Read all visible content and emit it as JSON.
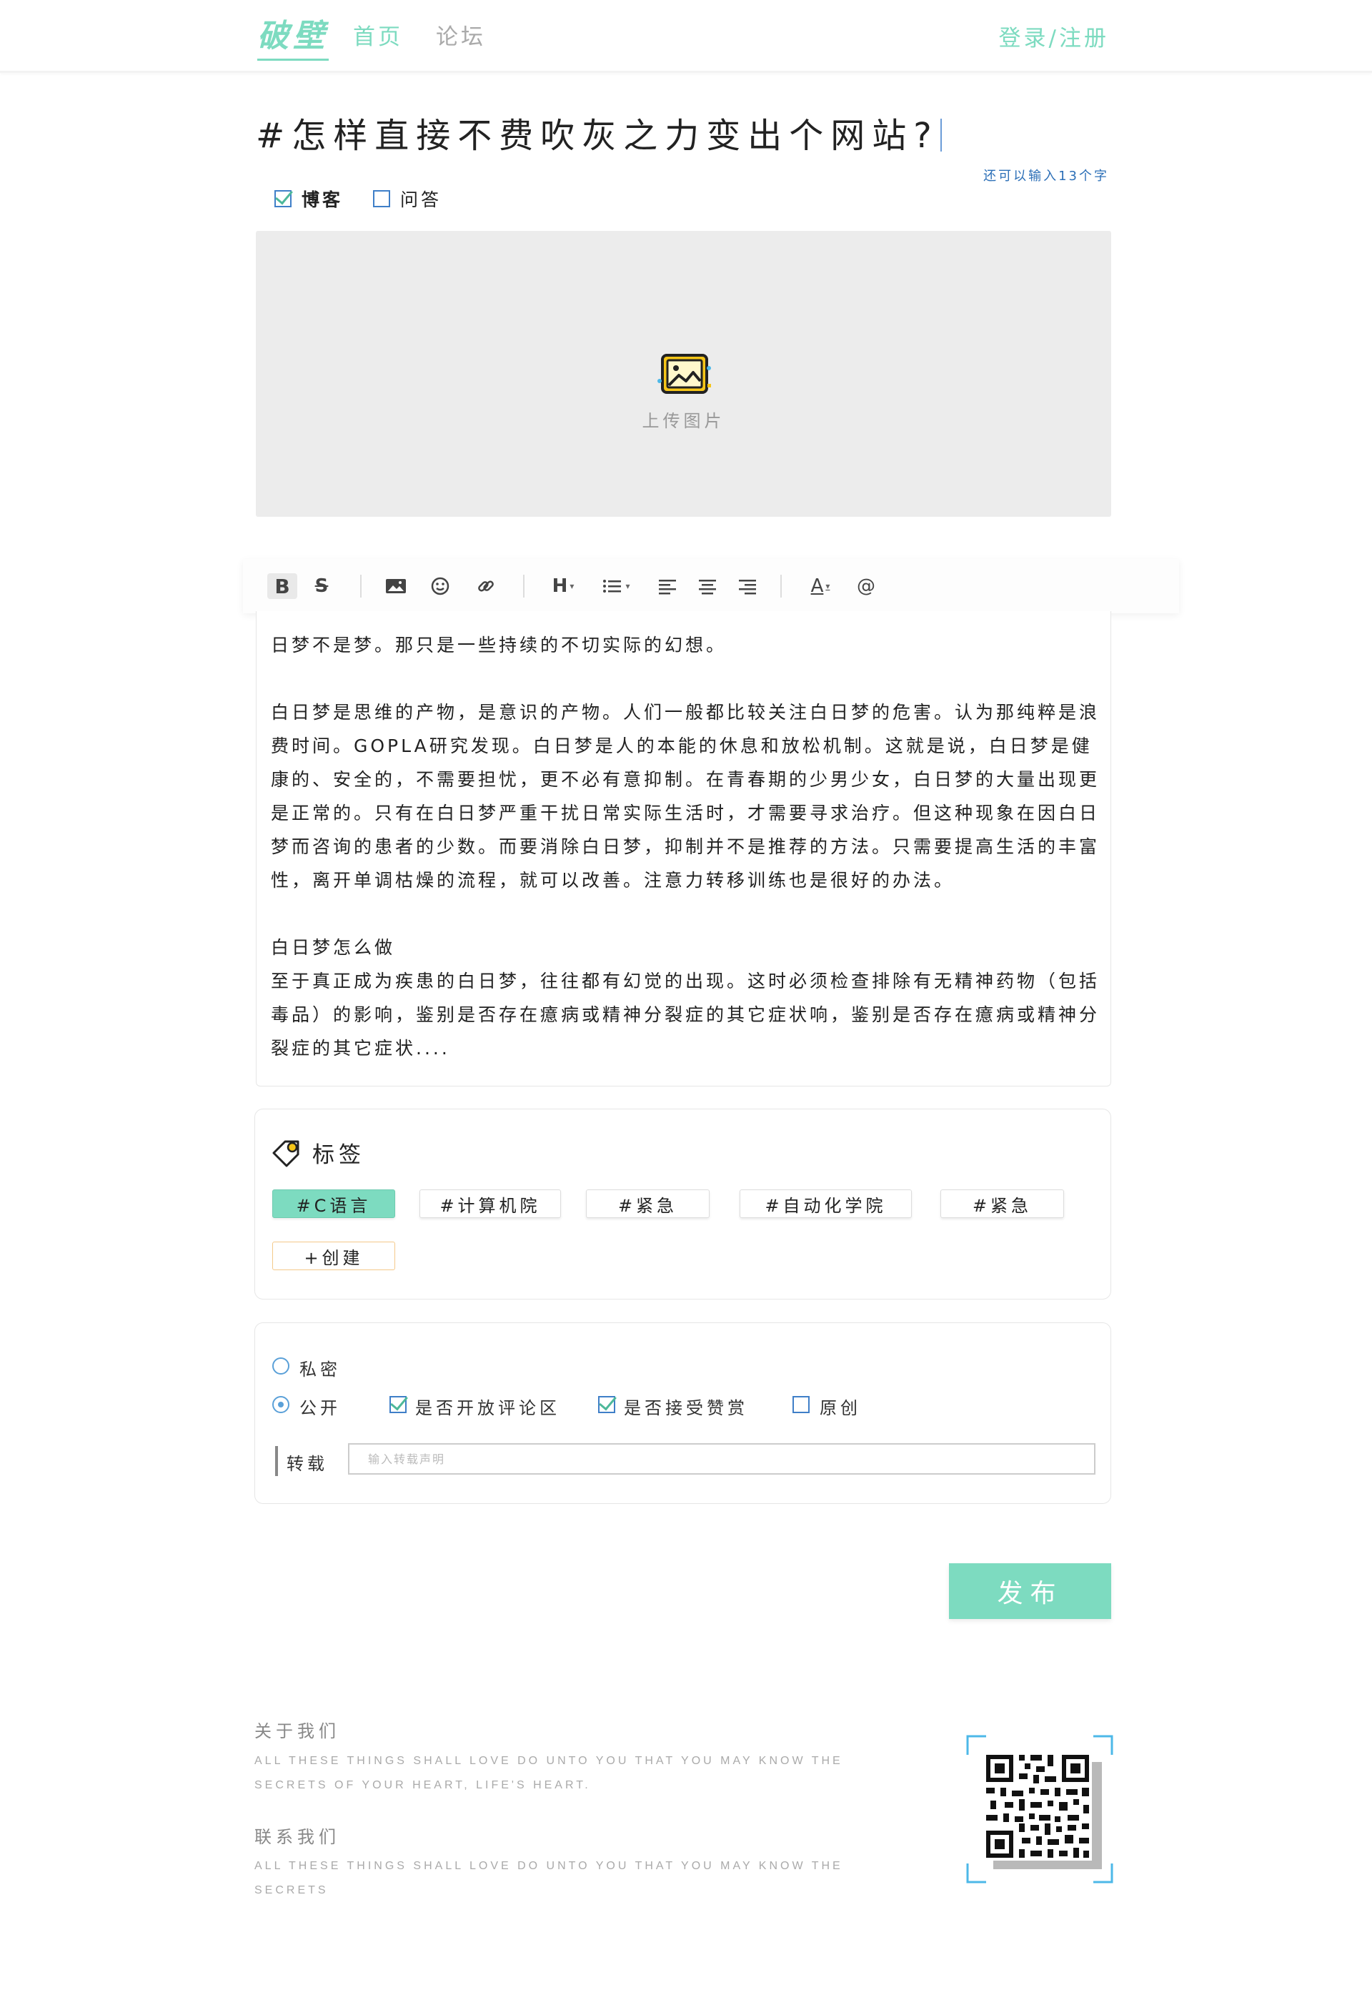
{
  "header": {
    "logo": "破壁",
    "nav_home": "首页",
    "nav_forum": "论坛",
    "login": "登录/注册"
  },
  "post": {
    "title": "#怎样直接不费吹灰之力变出个网站?",
    "remaining": "还可以输入13个字",
    "types": [
      {
        "label": "博客",
        "checked": true
      },
      {
        "label": "问答",
        "checked": false
      }
    ]
  },
  "upload": {
    "label": "上传图片",
    "icon": "image-icon"
  },
  "toolbar": {
    "bold": "B",
    "strikethrough": "S",
    "heading": "H",
    "font_color": "A",
    "mention": "@"
  },
  "editor": {
    "paragraphs": [
      "日梦不是梦。那只是一些持续的不切实际的幻想。",
      "白日梦是思维的产物，是意识的产物。人们一般都比较关注白日梦的危害。认为那纯粹是浪费时间。GOPLA研究发现。白日梦是人的本能的休息和放松机制。这就是说，白日梦是健康的、安全的，不需要担忧，更不必有意抑制。在青春期的少男少女，白日梦的大量出现更是正常的。只有在白日梦严重干扰日常实际生活时，才需要寻求治疗。但这种现象在因白日梦而咨询的患者的少数。而要消除白日梦，抑制并不是推荐的方法。只需要提高生活的丰富性，离开单调枯燥的流程，就可以改善。注意力转移训练也是很好的办法。",
      "白日梦怎么做",
      "至于真正成为疾患的白日梦，往往都有幻觉的出现。这时必须检查排除有无精神药物（包括毒品）的影响，鉴别是否存在癔病或精神分裂症的其它症状响，鉴别是否存在癔病或精神分裂症的其它症状...."
    ]
  },
  "tags": {
    "title": "标签",
    "items": [
      "#C语言",
      "#计算机院",
      "#紧急",
      "#自动化学院",
      "#紧急"
    ],
    "create": "+创建"
  },
  "settings": {
    "private": "私密",
    "public": "公开",
    "allow_comments": "是否开放评论区",
    "accept_reward": "是否接受赞赏",
    "original": "原创",
    "repost_label": "转载",
    "repost_placeholder": "输入转载声明"
  },
  "publish": "发布",
  "footer": {
    "about_title": "关于我们",
    "about_text": "ALL THESE THINGS SHALL LOVE DO UNTO YOU THAT YOU MAY KNOW THE SECRETS OF YOUR HEART, LIFE'S HEART.",
    "contact_title": "联系我们",
    "contact_text": "ALL THESE THINGS SHALL LOVE DO UNTO YOU THAT YOU MAY KNOW THE SECRETS"
  },
  "colors": {
    "accent": "#7ddbc0",
    "link_blue": "#2c6fb7",
    "checkbox_blue": "#3f7fc8"
  }
}
